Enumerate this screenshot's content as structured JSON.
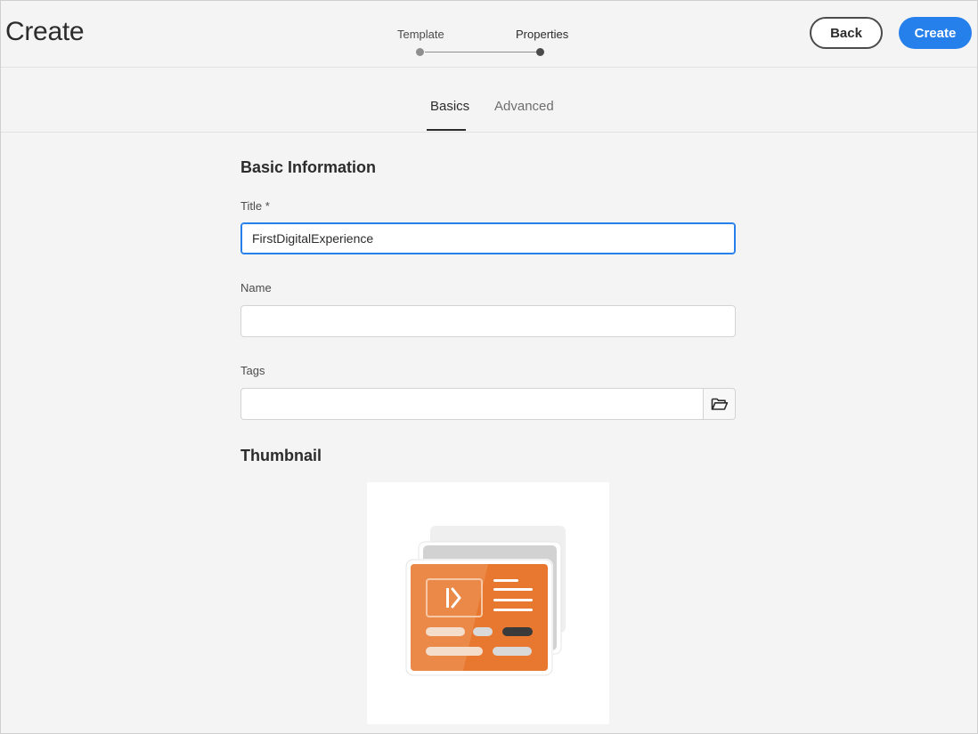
{
  "header": {
    "title": "Create",
    "steps": [
      {
        "label": "Template",
        "state": "done"
      },
      {
        "label": "Properties",
        "state": "current"
      }
    ],
    "back_label": "Back",
    "create_label": "Create"
  },
  "tabs": [
    {
      "label": "Basics",
      "active": true
    },
    {
      "label": "Advanced",
      "active": false
    }
  ],
  "form": {
    "basic_heading": "Basic Information",
    "title_label": "Title *",
    "title_value": "FirstDigitalExperience",
    "name_label": "Name",
    "name_value": "",
    "tags_label": "Tags",
    "tags_value": "",
    "tags_button_icon": "folder-open-icon",
    "thumbnail_heading": "Thumbnail",
    "thumbnail_icon": "experience-fragment-illustration"
  },
  "colors": {
    "accent": "#2680eb",
    "thumbnail_orange": "#e8782f",
    "background": "#f4f4f4"
  }
}
